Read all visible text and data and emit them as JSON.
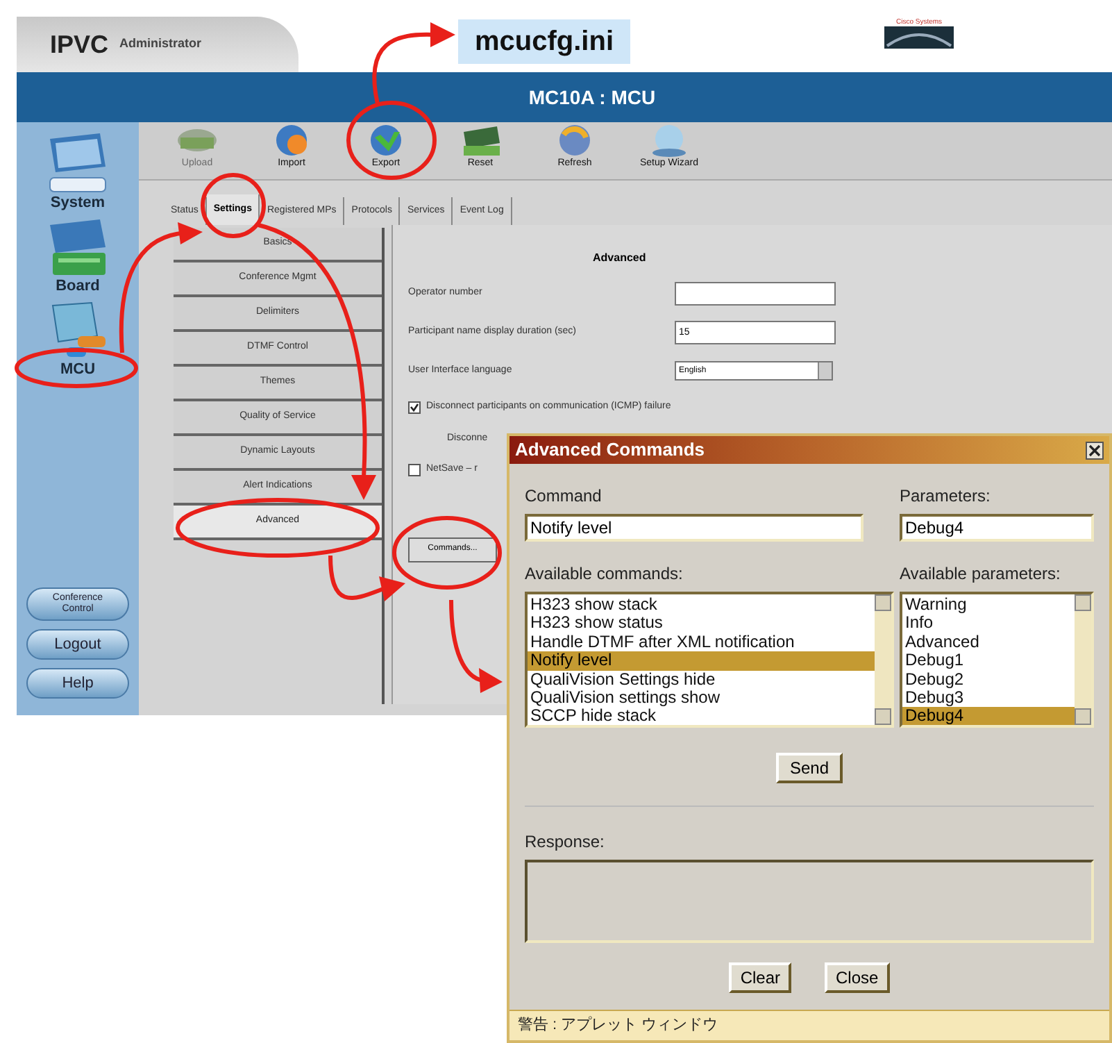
{
  "annotation_label": "mcucfg.ini",
  "app": {
    "title": "IPVC",
    "subtitle": "Administrator",
    "logo_text": "Cisco Systems",
    "header": "MC10A : MCU",
    "nav": [
      {
        "label": "System"
      },
      {
        "label": "Board"
      },
      {
        "label": "MCU"
      }
    ],
    "side_buttons": [
      "Conference Control",
      "Logout",
      "Help"
    ],
    "toolbar": [
      {
        "label": "Upload",
        "disabled": true
      },
      {
        "label": "Import",
        "disabled": false
      },
      {
        "label": "Export",
        "disabled": false
      },
      {
        "label": "Reset",
        "disabled": false
      },
      {
        "label": "Refresh",
        "disabled": false
      },
      {
        "label": "Setup Wizard",
        "disabled": false
      }
    ],
    "tabs": [
      {
        "label": "Status",
        "selected": false
      },
      {
        "label": "Settings",
        "selected": true
      },
      {
        "label": "Registered MPs",
        "selected": false
      },
      {
        "label": "Protocols",
        "selected": false
      },
      {
        "label": "Services",
        "selected": false
      },
      {
        "label": "Event Log",
        "selected": false
      }
    ],
    "categories": [
      {
        "label": "Basics",
        "selected": false
      },
      {
        "label": "Conference Mgmt",
        "selected": false
      },
      {
        "label": "Delimiters",
        "selected": false
      },
      {
        "label": "DTMF Control",
        "selected": false
      },
      {
        "label": "Themes",
        "selected": false
      },
      {
        "label": "Quality of Service",
        "selected": false
      },
      {
        "label": "Dynamic Layouts",
        "selected": false
      },
      {
        "label": "Alert Indications",
        "selected": false
      },
      {
        "label": "Advanced",
        "selected": true
      }
    ],
    "panel": {
      "heading": "Advanced",
      "fields": [
        {
          "kind": "text",
          "label": "Operator number"
        },
        {
          "kind": "text",
          "label": "Participant name display duration (sec)",
          "value": "15"
        },
        {
          "kind": "select",
          "label": "User Interface language",
          "value": "English"
        }
      ],
      "options": [
        {
          "kind": "checkbox",
          "label": "Disconnect participants on communication (ICMP) failure",
          "checked": true
        },
        {
          "kind": "note",
          "label": "Disconne"
        },
        {
          "kind": "checkbox",
          "label": "NetSave – r",
          "checked": false
        }
      ],
      "commands_button": "Commands..."
    }
  },
  "dialog": {
    "title": "Advanced Commands",
    "command_label": "Command",
    "command_value": "Notify level",
    "parameters_label": "Parameters:",
    "parameters_value": "Debug4",
    "commands_list_label": "Available commands:",
    "commands": [
      {
        "label": "H323 show stack",
        "selected": false
      },
      {
        "label": "H323 show status",
        "selected": false
      },
      {
        "label": "Handle DTMF after XML notification",
        "selected": false
      },
      {
        "label": "Notify level",
        "selected": true
      },
      {
        "label": "QualiVision Settings hide",
        "selected": false
      },
      {
        "label": "QualiVision settings show",
        "selected": false
      },
      {
        "label": "SCCP hide stack",
        "selected": false
      }
    ],
    "parameters_list_label": "Available parameters:",
    "parameters": [
      {
        "label": "Warning",
        "selected": false
      },
      {
        "label": "Info",
        "selected": false
      },
      {
        "label": "Advanced",
        "selected": false
      },
      {
        "label": "Debug1",
        "selected": false
      },
      {
        "label": "Debug2",
        "selected": false
      },
      {
        "label": "Debug3",
        "selected": false
      },
      {
        "label": "Debug4",
        "selected": true
      }
    ],
    "send": "Send",
    "response_label": "Response:",
    "buttons": [
      "Clear",
      "Close"
    ],
    "status": "警告 : アプレット ウィンドウ"
  }
}
